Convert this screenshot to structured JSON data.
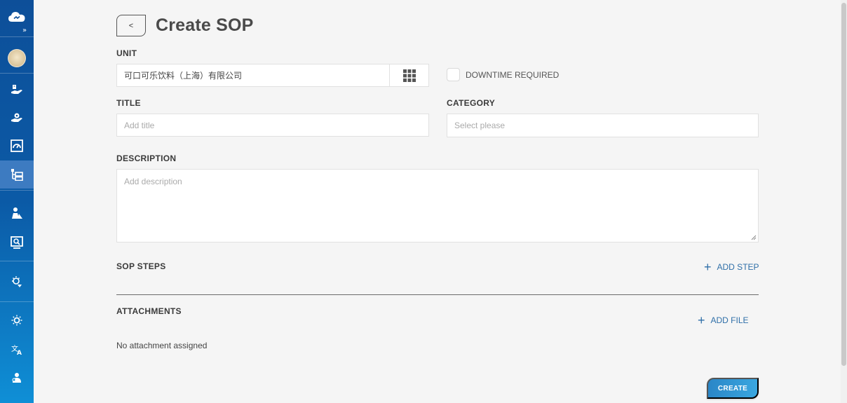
{
  "sidebar": {
    "expand_glyph": "»",
    "items": [
      {
        "icon": "cloud-logo-icon"
      },
      {
        "icon": "user-avatar"
      },
      {
        "icon": "hand-gear-icon"
      },
      {
        "icon": "hand-gear-alt-icon"
      },
      {
        "icon": "gauge-icon"
      },
      {
        "icon": "sop-tree-icon",
        "active": true
      },
      {
        "icon": "worker-icon"
      },
      {
        "icon": "monitor-check-icon"
      },
      {
        "icon": "bulb-icon"
      },
      {
        "icon": "settings-sun-icon"
      },
      {
        "icon": "translate-icon"
      },
      {
        "icon": "profile-icon"
      }
    ]
  },
  "header": {
    "back_label": "<",
    "title": "Create SOP"
  },
  "form": {
    "unit": {
      "label": "UNIT",
      "value": "可口可乐饮料（上海）有限公司"
    },
    "downtime": {
      "label": "DOWNTIME REQUIRED",
      "checked": false
    },
    "title": {
      "label": "TITLE",
      "placeholder": "Add title"
    },
    "category": {
      "label": "CATEGORY",
      "placeholder": "Select please"
    },
    "description": {
      "label": "DESCRIPTION",
      "placeholder": "Add description"
    }
  },
  "sop_steps": {
    "label": "SOP STEPS",
    "add_label": "ADD STEP"
  },
  "attachments": {
    "label": "ATTACHMENTS",
    "add_label": "ADD FILE",
    "empty_text": "No attachment assigned"
  },
  "actions": {
    "create_label": "CREATE"
  },
  "colors": {
    "sidebar": "#0d4f99",
    "accent": "#2f6fa8",
    "create_button": "#2a86c7"
  }
}
